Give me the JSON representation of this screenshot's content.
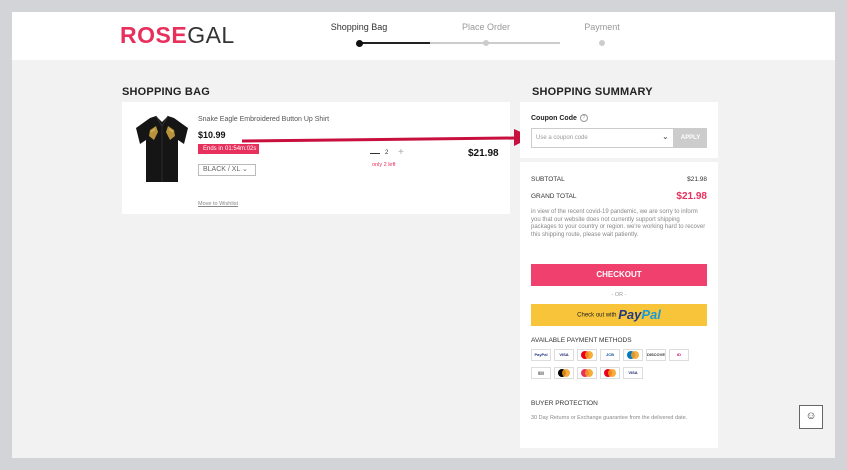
{
  "brand": {
    "bold": "ROSE",
    "light": "GAL"
  },
  "steps": [
    {
      "label": "Shopping Bag",
      "active": true
    },
    {
      "label": "Place Order",
      "active": false
    },
    {
      "label": "Payment",
      "active": false
    }
  ],
  "bag": {
    "title": "SHOPPING BAG",
    "item": {
      "name": "Snake Eagle Embroidered Button Up Shirt",
      "price": "$10.99",
      "ends_label": "Ends in",
      "ends_timer": "01:54m:02s",
      "variant": "BLACK / XL",
      "quantity": "2",
      "stock_note": "only 2 left",
      "line_total": "$21.98",
      "wishlist": "Move to Wishlist"
    }
  },
  "summary": {
    "title": "SHOPPING SUMMARY",
    "coupon_label": "Coupon Code",
    "coupon_help": "?",
    "coupon_placeholder": "Use a coupon code",
    "apply": "APPLY",
    "subtotal_label": "SUBTOTAL",
    "subtotal": "$21.98",
    "grand_label": "GRAND TOTAL",
    "grand_total": "$21.98",
    "notice": "in view of the recent covid-19 pandemic, we are sorry to inform you that our website does not currently support shipping packages to your country or region. we're working hard to recover this shipping route, please wait patiently.",
    "checkout": "CHECKOUT",
    "or": "- OR -",
    "paypal_prefix": "Check out with",
    "paypal_a": "Pay",
    "paypal_b": "Pal",
    "methods_title": "AVAILABLE PAYMENT METHODS",
    "protection_title": "BUYER PROTECTION",
    "protection_text": "30 Day Returns or Exchange guarantee from the delivered date."
  },
  "payment_methods": [
    {
      "name": "paypal-card-icon",
      "text": "PayPal",
      "bg": "#ffffff",
      "fg": "#253b80"
    },
    {
      "name": "visa-icon",
      "text": "VISA",
      "bg": "#ffffff",
      "fg": "#1a1f71"
    },
    {
      "name": "mastercard-icon",
      "text": "",
      "bg": "#ffffff",
      "fg": "#eb001b"
    },
    {
      "name": "jcb-icon",
      "text": "JCB",
      "bg": "#ffffff",
      "fg": "#0e4c96"
    },
    {
      "name": "diners-icon",
      "text": "",
      "bg": "#ffffff",
      "fg": "#0079be"
    },
    {
      "name": "discover-icon",
      "text": "DISCOVER",
      "bg": "#ffffff",
      "fg": "#333333"
    },
    {
      "name": "ideal-icon",
      "text": "iD",
      "bg": "#ffffff",
      "fg": "#cc0066"
    },
    {
      "name": "boleto-icon",
      "text": "|||||",
      "bg": "#ffffff",
      "fg": "#333333"
    },
    {
      "name": "giropay-icon",
      "text": "",
      "bg": "#ffffff",
      "fg": "#000000"
    },
    {
      "name": "sofort-icon",
      "text": "",
      "bg": "#ffffff",
      "fg": "#e8305d"
    },
    {
      "name": "maestro-icon",
      "text": "",
      "bg": "#ffffff",
      "fg": "#eb001b"
    },
    {
      "name": "visa-electron-icon",
      "text": "VISA",
      "bg": "#ffffff",
      "fg": "#1a1f71"
    }
  ],
  "colors": {
    "accent": "#e8305d",
    "paypal": "#f7c43a",
    "background": "#f2f2f2"
  }
}
